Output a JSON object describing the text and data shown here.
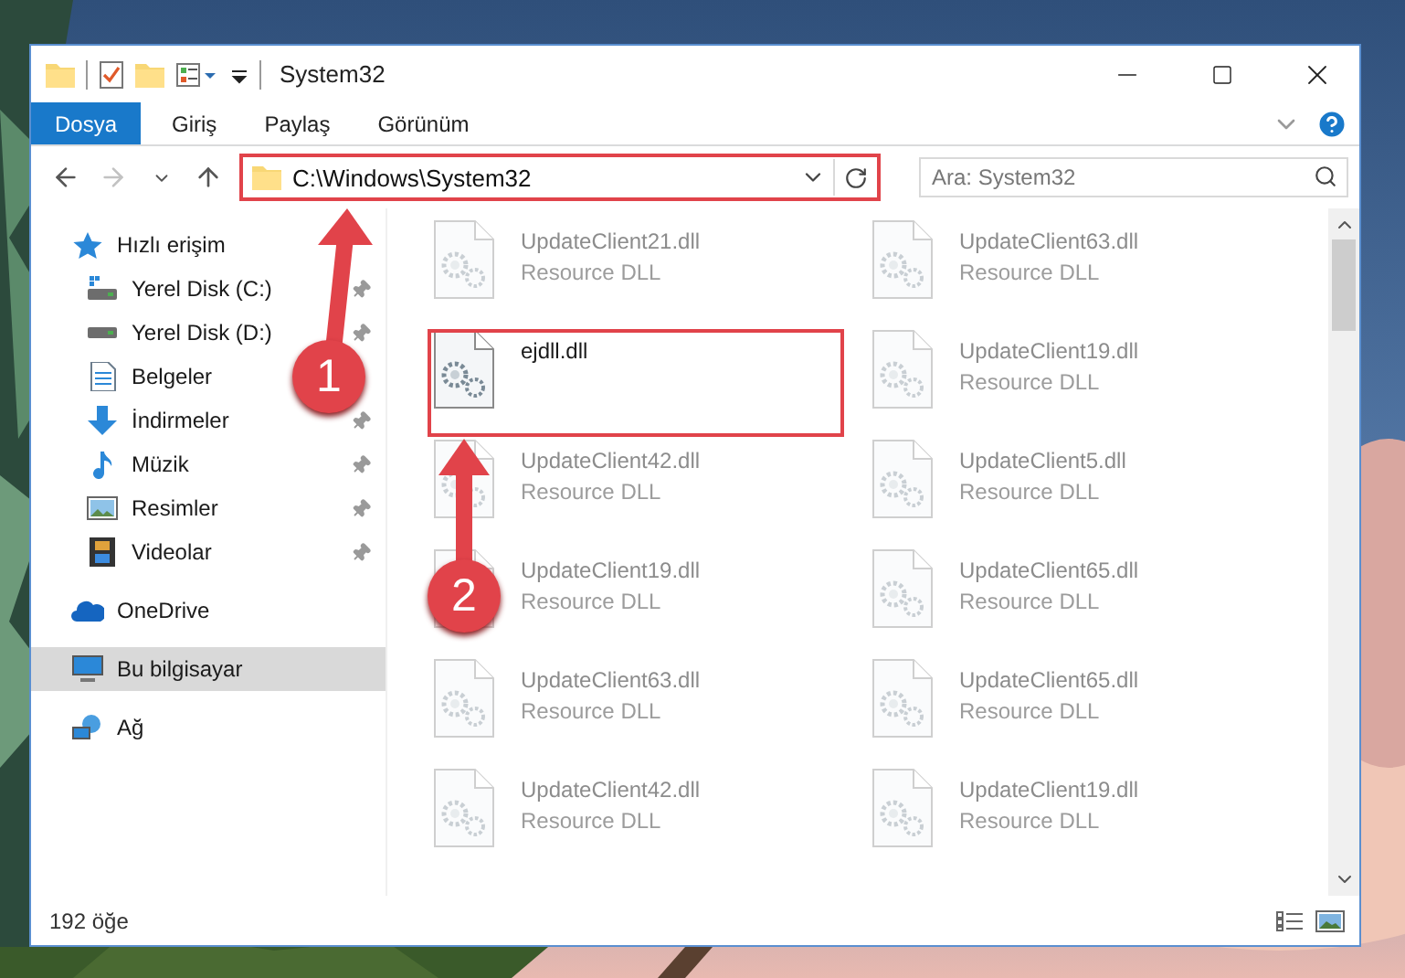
{
  "window": {
    "title": "System32"
  },
  "ribbon_tabs": [
    {
      "label": "Dosya",
      "selected": true
    },
    {
      "label": "Giriş",
      "selected": false
    },
    {
      "label": "Paylaş",
      "selected": false
    },
    {
      "label": "Görünüm",
      "selected": false
    }
  ],
  "address_bar": {
    "path": "C:\\Windows\\System32",
    "highlighted": true
  },
  "search": {
    "placeholder": "Ara: System32"
  },
  "sidebar": {
    "items": [
      {
        "label": "Hızlı erişim",
        "kind": "quick",
        "selected": false,
        "children": [
          {
            "label": "Yerel Disk (C:)",
            "kind": "system-drive",
            "pinned": true,
            "selected": false
          },
          {
            "label": "Yerel Disk (D:)",
            "kind": "drive",
            "pinned": true,
            "selected": false
          },
          {
            "label": "Belgeler",
            "kind": "documents",
            "pinned": false,
            "selected": false
          },
          {
            "label": "İndirmeler",
            "kind": "downloads",
            "pinned": true,
            "selected": false
          },
          {
            "label": "Müzik",
            "kind": "music",
            "pinned": true,
            "selected": false
          },
          {
            "label": "Resimler",
            "kind": "pictures",
            "pinned": true,
            "selected": false
          },
          {
            "label": "Videolar",
            "kind": "videos",
            "pinned": true,
            "selected": false
          }
        ]
      },
      {
        "label": "OneDrive",
        "kind": "cloud",
        "selected": false
      },
      {
        "label": "Bu bilgisayar",
        "kind": "computer",
        "selected": true
      },
      {
        "label": "Ağ",
        "kind": "network",
        "selected": false
      }
    ]
  },
  "files": [
    {
      "name": "UpdateClient21.dll",
      "type": "Resource DLL",
      "highlighted": false
    },
    {
      "name": "UpdateClient63.dll",
      "type": "Resource DLL",
      "highlighted": false
    },
    {
      "name": "ejdll.dll",
      "highlighted": true
    },
    {
      "name": "UpdateClient19.dll",
      "type": "Resource DLL",
      "highlighted": false
    },
    {
      "name": "UpdateClient42.dll",
      "type": "Resource DLL",
      "highlighted": false
    },
    {
      "name": "UpdateClient5.dll",
      "type": "Resource DLL",
      "highlighted": false
    },
    {
      "name": "UpdateClient19.dll",
      "type": "Resource DLL",
      "highlighted": false
    },
    {
      "name": "UpdateClient65.dll",
      "type": "Resource DLL",
      "highlighted": false
    },
    {
      "name": "UpdateClient63.dll",
      "type": "Resource DLL",
      "highlighted": false
    },
    {
      "name": "UpdateClient65.dll",
      "type": "Resource DLL",
      "highlighted": false
    },
    {
      "name": "UpdateClient42.dll",
      "type": "Resource DLL",
      "highlighted": false
    },
    {
      "name": "UpdateClient19.dll",
      "type": "Resource DLL",
      "highlighted": false
    }
  ],
  "annotations": [
    {
      "label": "1"
    },
    {
      "label": "2"
    }
  ],
  "status_bar": {
    "item_count": "192 öğe"
  }
}
